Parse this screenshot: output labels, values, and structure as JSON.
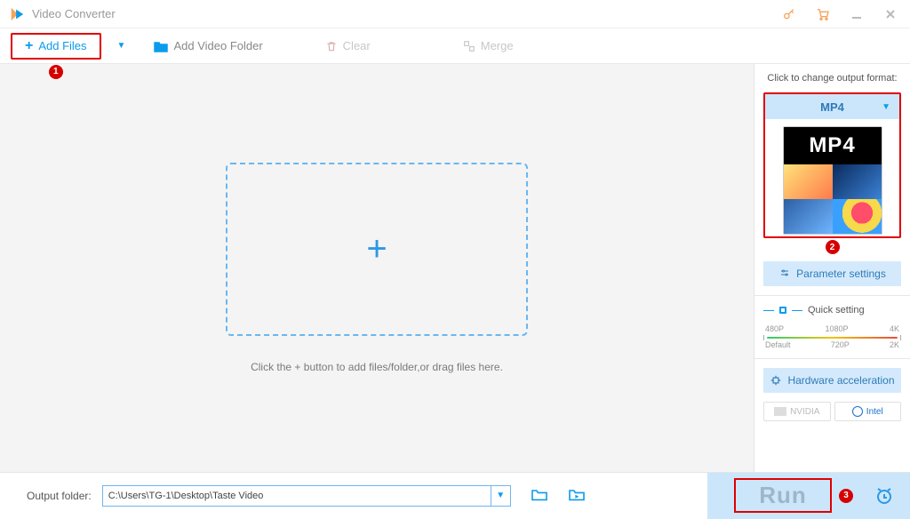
{
  "app": {
    "title": "Video Converter"
  },
  "toolbar": {
    "add_files": "Add Files",
    "add_folder": "Add Video Folder",
    "clear": "Clear",
    "merge": "Merge"
  },
  "dropzone": {
    "hint": "Click the + button to add files/folder,or drag files here."
  },
  "side": {
    "header": "Click to change output format:",
    "format": "MP4",
    "thumb_tag": "MP4",
    "param_btn": "Parameter settings",
    "quick_label": "Quick setting",
    "ticks_top": [
      "480P",
      "1080P",
      "4K"
    ],
    "ticks_bottom": [
      "Default",
      "720P",
      "2K"
    ],
    "hw_btn": "Hardware acceleration",
    "nvidia": "NVIDIA",
    "intel": "Intel"
  },
  "bottom": {
    "label": "Output folder:",
    "path": "C:\\Users\\TG-1\\Desktop\\Taste Video",
    "run": "Run"
  },
  "annotations": {
    "a1": "1",
    "a2": "2",
    "a3": "3"
  }
}
